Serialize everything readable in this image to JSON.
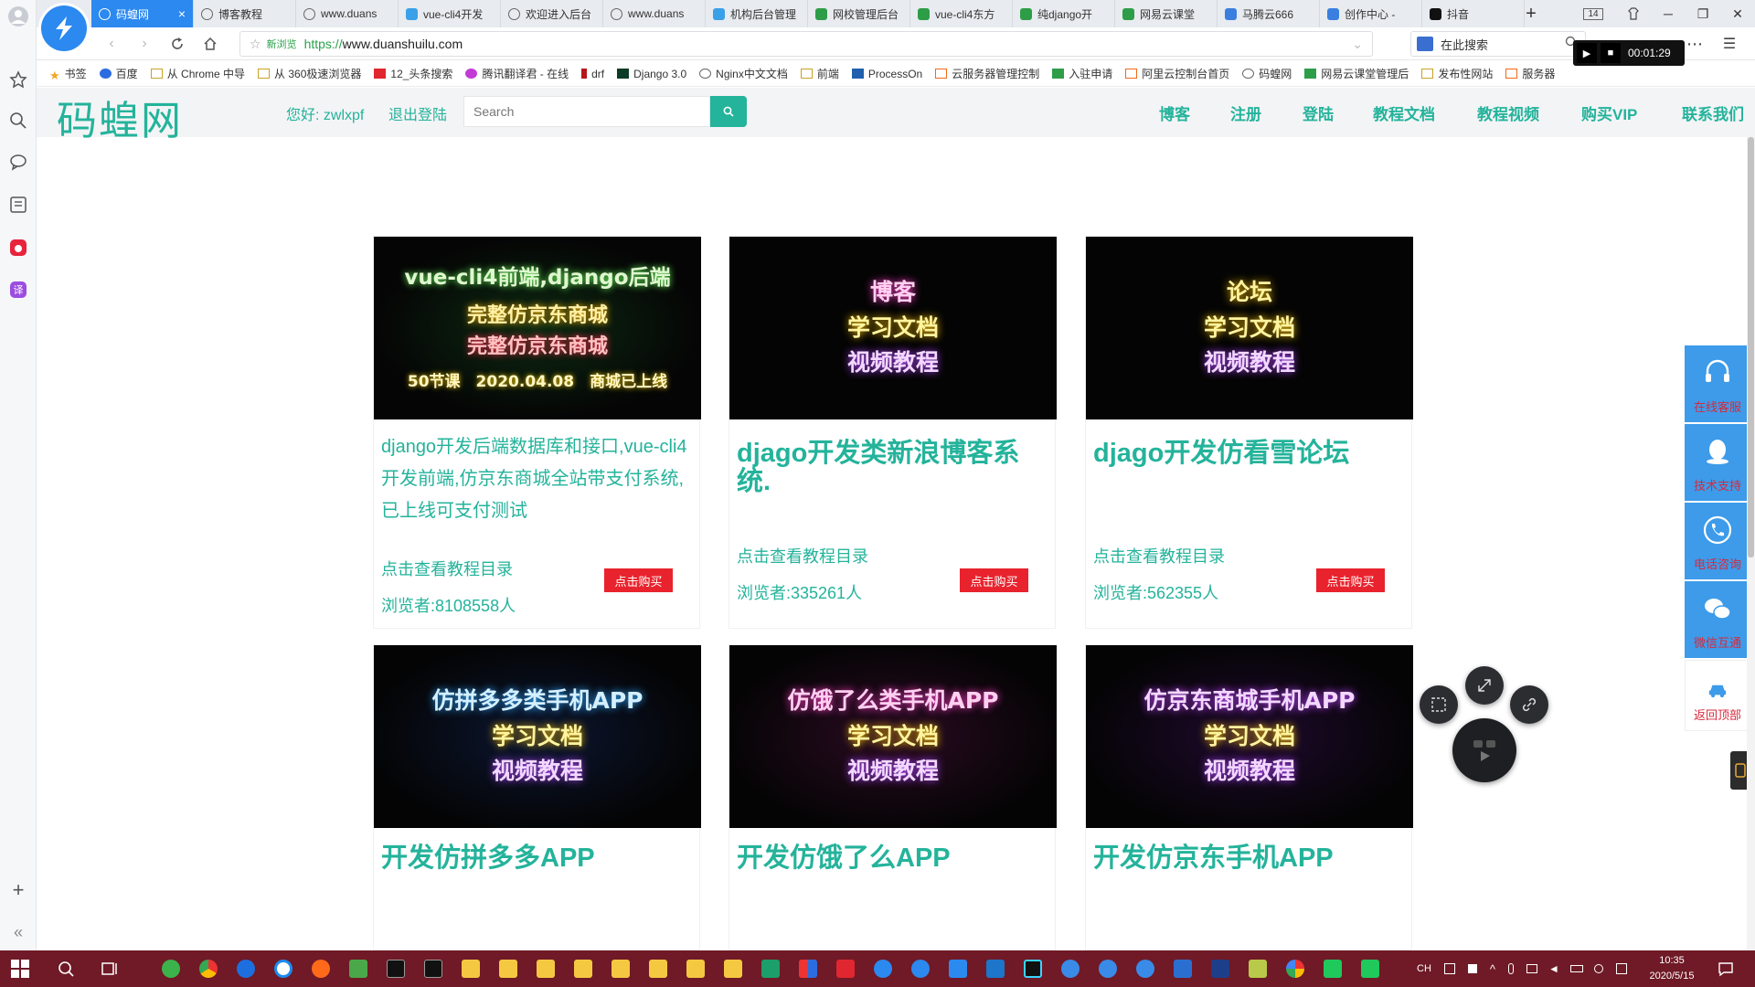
{
  "browser": {
    "tabs": [
      {
        "label": "码蝗网",
        "active": true,
        "close": "×"
      },
      {
        "label": "博客教程"
      },
      {
        "label": "www.duans"
      },
      {
        "label": "vue-cli4开发"
      },
      {
        "label": "欢迎进入后台"
      },
      {
        "label": "www.duans"
      },
      {
        "label": "机构后台管理"
      },
      {
        "label": "网校管理后台"
      },
      {
        "label": "vue-cli4东方"
      },
      {
        "label": "纯django开"
      },
      {
        "label": "网易云课堂"
      },
      {
        "label": "马腾云666"
      },
      {
        "label": "创作中心 - "
      },
      {
        "label": "抖音"
      }
    ],
    "new_tab": "+",
    "tab_count": "14",
    "window_controls": {
      "minimize": "─",
      "restore": "❐",
      "close": "✕"
    },
    "url_tag": "新浏览",
    "url_scheme": "https://",
    "url_rest": "www.duanshuilu.com",
    "search_placeholder": "在此搜索",
    "recorder_time": "00:01:29",
    "more": "⋯",
    "menu": "☰"
  },
  "bookmarks": [
    "书签",
    "百度",
    "从 Chrome 中导",
    "从 360极速浏览器",
    "12_头条搜索",
    "腾讯翻译君 - 在线",
    "drf",
    "Django 3.0",
    "Nginx中文文档",
    "前端",
    "ProcessOn",
    "云服务器管理控制",
    "入驻申请",
    "阿里云控制台首页",
    "码蝗网",
    "网易云课堂管理后",
    "发布性网站",
    "服务器"
  ],
  "site": {
    "logo": "码蝗网",
    "greeting": "您好: zwlxpf",
    "logout": "退出登陆",
    "search_placeholder": "Search",
    "nav": [
      "博客",
      "注册",
      "登陆",
      "教程文档",
      "教程视频",
      "购买VIP",
      "联系我们"
    ]
  },
  "cards": [
    {
      "thumb_lines": [
        "vue-cli4前端,django后端",
        "完整仿京东商城",
        "完整仿京东商城",
        "50节课　2020.04.08　商城已上线"
      ],
      "title": "django开发后端数据库和接口,vue-cli4开发前端,仿京东商城全站带支付系统,已上线可支付测试",
      "toc": "点击查看教程目录",
      "views": "浏览者:8108558人",
      "buy": "点击购买"
    },
    {
      "thumb_lines": [
        "博客",
        "学习文档",
        "视频教程"
      ],
      "title": "djago开发类新浪博客系统.",
      "toc": "点击查看教程目录",
      "views": "浏览者:335261人",
      "buy": "点击购买"
    },
    {
      "thumb_lines": [
        "论坛",
        "学习文档",
        "视频教程"
      ],
      "title": "djago开发仿看雪论坛",
      "toc": "点击查看教程目录",
      "views": "浏览者:562355人",
      "buy": "点击购买"
    },
    {
      "thumb_lines": [
        "仿拼多多类手机APP",
        "学习文档",
        "视频教程"
      ],
      "title": "开发仿拼多多APP"
    },
    {
      "thumb_lines": [
        "仿饿了么类手机APP",
        "学习文档",
        "视频教程"
      ],
      "title": "开发仿饿了么APP"
    },
    {
      "thumb_lines": [
        "仿京东商城手机APP",
        "学习文档",
        "视频教程"
      ],
      "title": "开发仿京东手机APP"
    }
  ],
  "service_bar": [
    "在线客服",
    "技术支持",
    "电话咨询",
    "微信互通",
    "返回顶部"
  ],
  "taskbar": {
    "ime": "CH",
    "time": "10:35",
    "date": "2020/5/15"
  },
  "colors": {
    "brand": "#24b39b",
    "buy": "#e8232d",
    "taskbar": "#6f1a26",
    "tab_active": "#2b89f0"
  }
}
